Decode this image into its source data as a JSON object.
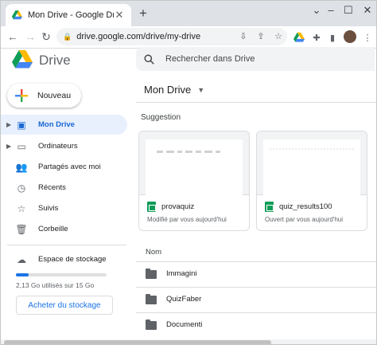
{
  "browser": {
    "tab_title": "Mon Drive - Google Drive",
    "tab_close_icon": "close-icon",
    "new_tab_icon": "plus-icon",
    "url": "drive.google.com/drive/my-drive"
  },
  "header": {
    "app_name": "Drive",
    "search_placeholder": "Rechercher dans Drive"
  },
  "sidebar": {
    "new_label": "Nouveau",
    "items": [
      {
        "label": "Mon Drive",
        "icon": "drive-icon",
        "active": true
      },
      {
        "label": "Ordinateurs",
        "icon": "computer-icon",
        "active": false
      },
      {
        "label": "Partagés avec moi",
        "icon": "shared-icon",
        "active": false
      },
      {
        "label": "Récents",
        "icon": "clock-icon",
        "active": false
      },
      {
        "label": "Suivis",
        "icon": "star-icon",
        "active": false
      },
      {
        "label": "Corbeille",
        "icon": "trash-icon",
        "active": false
      }
    ],
    "storage": {
      "label": "Espace de stockage",
      "used_text": "2,13 Go utilisés sur 15 Go",
      "used_fraction": 0.142,
      "buy_label": "Acheter du stockage"
    }
  },
  "main": {
    "title": "Mon Drive",
    "suggestion_label": "Suggestion",
    "cards": [
      {
        "name": "provaquiz",
        "sub": "Modifié par vous aujourd'hui"
      },
      {
        "name": "quiz_results100",
        "sub": "Ouvert par vous aujourd'hui"
      }
    ],
    "column_name": "Nom",
    "folders": [
      "Immagini",
      "QuizFaber",
      "Documenti"
    ]
  },
  "colors": {
    "accent": "#1a73e8",
    "active_bg": "#e8f0fe",
    "sheets_green": "#0f9d58"
  }
}
